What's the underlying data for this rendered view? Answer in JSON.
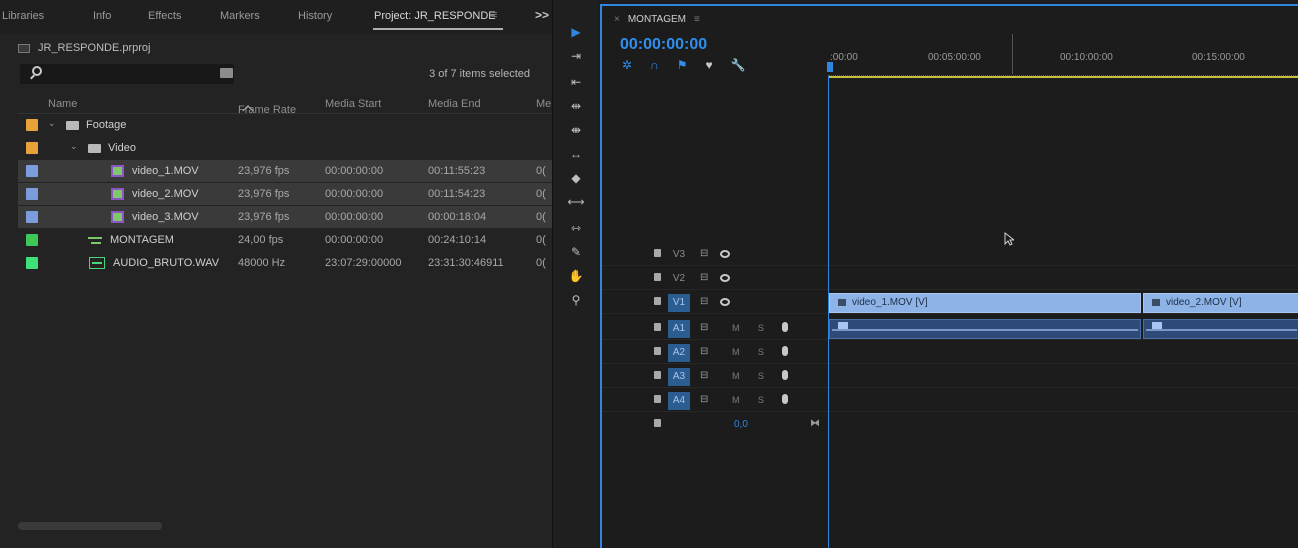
{
  "project_panel": {
    "tabs": [
      "Libraries",
      "Info",
      "Effects",
      "Markers",
      "History",
      "Project: JR_RESPONDE"
    ],
    "active_tab": "Project: JR_RESPONDE",
    "overflow": ">>",
    "project_file": "JR_RESPONDE.prproj",
    "search_placeholder": "",
    "items_status": "3 of 7 items selected",
    "columns": [
      "Name",
      "Frame Rate",
      "Media Start",
      "Media End",
      "Me"
    ],
    "rows": [
      {
        "label_color": "#e8a23a",
        "type": "folder",
        "name": "Footage",
        "frame_rate": "",
        "media_start": "",
        "media_end": "",
        "extra": "",
        "selected": false
      },
      {
        "label_color": "#e8a23a",
        "type": "folder",
        "name": "Video",
        "frame_rate": "",
        "media_start": "",
        "media_end": "",
        "extra": "",
        "selected": false
      },
      {
        "label_color": "#7d9cde",
        "type": "clip",
        "name": "video_1.MOV",
        "frame_rate": "23,976 fps",
        "media_start": "00:00:00:00",
        "media_end": "00:11:55:23",
        "extra": "0(",
        "selected": true
      },
      {
        "label_color": "#7d9cde",
        "type": "clip",
        "name": "video_2.MOV",
        "frame_rate": "23,976 fps",
        "media_start": "00:00:00:00",
        "media_end": "00:11:54:23",
        "extra": "0(",
        "selected": true
      },
      {
        "label_color": "#7d9cde",
        "type": "clip",
        "name": "video_3.MOV",
        "frame_rate": "23,976 fps",
        "media_start": "00:00:00:00",
        "media_end": "00:00:18:04",
        "extra": "0(",
        "selected": true
      },
      {
        "label_color": "#3ec85a",
        "type": "sequence",
        "name": "MONTAGEM",
        "frame_rate": "24,00 fps",
        "media_start": "00:00:00:00",
        "media_end": "00:24:10:14",
        "extra": "0(",
        "selected": false
      },
      {
        "label_color": "#3ee07a",
        "type": "audio",
        "name": "AUDIO_BRUTO.WAV",
        "frame_rate": "48000 Hz",
        "media_start": "23:07:29:00000",
        "media_end": "23:31:30:46911",
        "extra": "0(",
        "selected": false
      }
    ]
  },
  "tools": [
    "selection-tool",
    "track-select-tool",
    "track-select-backward-tool",
    "ripple-edit-tool",
    "rolling-edit-tool",
    "rate-stretch-tool",
    "razor-tool",
    "slip-tool",
    "slide-tool",
    "pen-tool",
    "hand-tool",
    "zoom-tool"
  ],
  "timeline": {
    "sequence_name": "MONTAGEM",
    "timecode": "00:00:00:00",
    "ruler_labels": [
      ":00:00",
      "00:05:00:00",
      "00:10:00:00",
      "00:15:00:00"
    ],
    "video_tracks": [
      {
        "name": "V3",
        "on": false
      },
      {
        "name": "V2",
        "on": false
      },
      {
        "name": "V1",
        "on": true
      }
    ],
    "audio_tracks": [
      {
        "name": "A1",
        "on": true
      },
      {
        "name": "A2",
        "on": true
      },
      {
        "name": "A3",
        "on": true
      },
      {
        "name": "A4",
        "on": true
      }
    ],
    "master_volume": "0,0",
    "clips": {
      "v1": [
        "video_1.MOV [V]",
        "video_2.MOV [V]"
      ]
    },
    "ms_labels": {
      "mute": "M",
      "solo": "S"
    }
  }
}
